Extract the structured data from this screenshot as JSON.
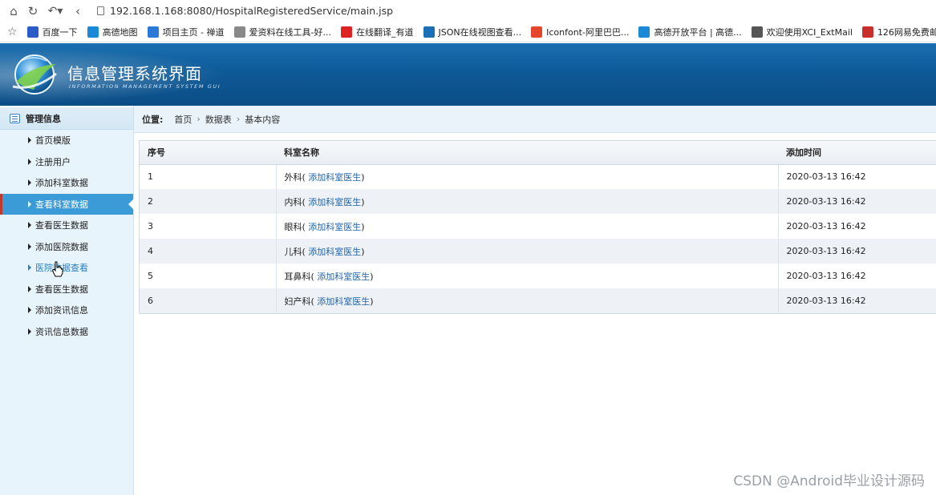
{
  "browser": {
    "url": "192.168.1.168:8080/HospitalRegisteredService/main.jsp",
    "bookmarks": [
      {
        "label": "百度一下",
        "icon": "baidu-icon",
        "color": "#2b5cc8"
      },
      {
        "label": "高德地图",
        "icon": "amap-icon",
        "color": "#1a8ad6"
      },
      {
        "label": "项目主页 - 禅道",
        "icon": "zentao-icon",
        "color": "#2a7ad8"
      },
      {
        "label": "爱资料在线工具-好...",
        "icon": "tool-icon",
        "color": "#888888"
      },
      {
        "label": "在线翻译_有道",
        "icon": "youdao-icon",
        "color": "#d22"
      },
      {
        "label": "JSON在线视图查看...",
        "icon": "json-icon",
        "color": "#1b6fb5"
      },
      {
        "label": "Iconfont-阿里巴巴...",
        "icon": "iconfont-icon",
        "color": "#e5462c"
      },
      {
        "label": "高德开放平台 | 高德...",
        "icon": "amap-open-icon",
        "color": "#1a8ad6"
      },
      {
        "label": "欢迎使用XCI_ExtMail",
        "icon": "mail-icon",
        "color": "#555555"
      },
      {
        "label": "126网易免费邮--你...",
        "icon": "mail126-icon",
        "color": "#c9302c"
      }
    ]
  },
  "header": {
    "title": "信息管理系统界面",
    "subtitle": "INFORMATION MANAGEMENT SYSTEM GUI"
  },
  "sidebar": {
    "heading": "管理信息",
    "items": [
      {
        "label": "首页模版"
      },
      {
        "label": "注册用户"
      },
      {
        "label": "添加科室数据"
      },
      {
        "label": "查看科室数据",
        "active": true
      },
      {
        "label": "查看医生数据"
      },
      {
        "label": "添加医院数据"
      },
      {
        "label": "医院数据查看",
        "hover": true
      },
      {
        "label": "查看医生数据"
      },
      {
        "label": "添加资讯信息"
      },
      {
        "label": "资讯信息数据"
      }
    ]
  },
  "breadcrumb": {
    "title": "位置:",
    "items": [
      "首页",
      "数据表",
      "基本内容"
    ]
  },
  "table": {
    "headers": [
      "序号",
      "科室名称",
      "添加时间"
    ],
    "link_label": "添加科室医生",
    "rows": [
      {
        "id": "1",
        "dept": "外科",
        "time": "2020-03-13 16:42"
      },
      {
        "id": "2",
        "dept": "内科",
        "time": "2020-03-13 16:42"
      },
      {
        "id": "3",
        "dept": "眼科",
        "time": "2020-03-13 16:42"
      },
      {
        "id": "4",
        "dept": "儿科",
        "time": "2020-03-13 16:42"
      },
      {
        "id": "5",
        "dept": "耳鼻科",
        "time": "2020-03-13 16:42"
      },
      {
        "id": "6",
        "dept": "妇产科",
        "time": "2020-03-13 16:42"
      }
    ]
  },
  "watermark": "CSDN @Android毕业设计源码",
  "colors": {
    "header_blue": "#0e5a98",
    "sidebar_bg": "#e8f4fb",
    "active_item": "#3a9bd6",
    "link": "#1f63a8"
  }
}
